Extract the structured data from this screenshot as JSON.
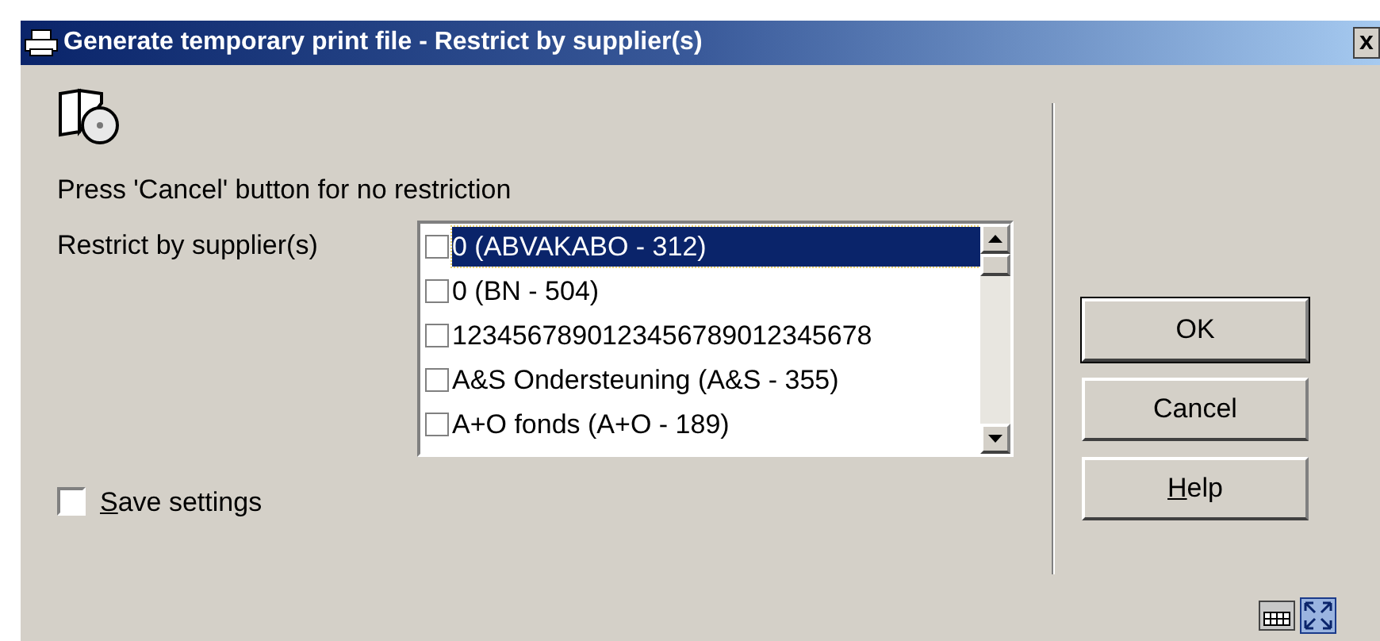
{
  "window": {
    "title": "Generate temporary print file - Restrict by supplier(s)",
    "close": "x"
  },
  "instruction": "Press 'Cancel' button for no restriction",
  "supplier_field": {
    "label": "Restrict by supplier(s)",
    "items": [
      {
        "label": "0 (ABVAKABO - 312)",
        "checked": false,
        "selected": true
      },
      {
        "label": "0 (BN - 504)",
        "checked": false,
        "selected": false
      },
      {
        "label": "1234567890123456789012345678",
        "checked": false,
        "selected": false
      },
      {
        "label": "A&S Ondersteuning (A&S - 355)",
        "checked": false,
        "selected": false
      },
      {
        "label": "A+O fonds (A+O - 189)",
        "checked": false,
        "selected": false
      }
    ]
  },
  "save_settings": {
    "mnemonic": "S",
    "rest": "ave settings",
    "checked": false
  },
  "buttons": [
    {
      "kind": "default",
      "label": "OK"
    },
    {
      "kind": "normal",
      "label": "Cancel"
    },
    {
      "kind": "mnemonic",
      "mnemonic": "H",
      "rest": "elp"
    }
  ]
}
